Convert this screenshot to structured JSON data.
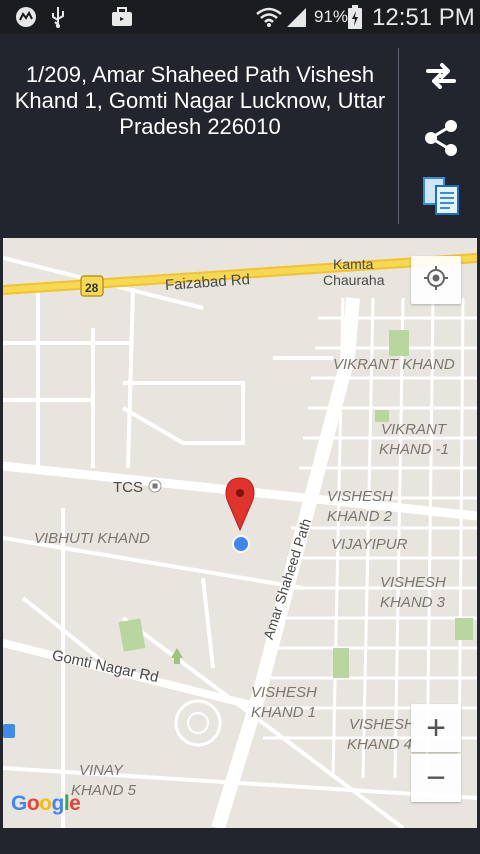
{
  "status_bar": {
    "icons": [
      "messenger-icon",
      "usb-icon",
      "briefcase-icon",
      "wifi-icon",
      "signal-icon",
      "battery-charging-icon"
    ],
    "battery": "91%",
    "time": "12:51 PM"
  },
  "header": {
    "address": "1/209, Amar Shaheed Path Vishesh Khand 1, Gomti Nagar Lucknow, Uttar Pradesh 226010",
    "actions": [
      "swap-icon",
      "share-icon",
      "copy-icon"
    ]
  },
  "map": {
    "labels": {
      "road_number": "28",
      "faizabad": "Faizabad Rd",
      "kamta1": "Kamta",
      "kamta2": "Chauraha",
      "vikrant_khand": "VIKRANT KHAND",
      "vikrant_khand1_a": "VIKRANT",
      "vikrant_khand1_b": "KHAND -1",
      "tcs": "TCS",
      "vishesh_khand2_a": "VISHESH",
      "vishesh_khand2_b": "KHAND 2",
      "vibhuti_khand": "VIBHUTI KHAND",
      "vijayipur": "VIJAYIPUR",
      "vishesh_khand3_a": "VISHESH",
      "vishesh_khand3_b": "KHAND 3",
      "amar_shaheed_path": "Amar Shaheed Path",
      "gomti_nagar_rd": "Gomti Nagar Rd",
      "vishesh_khand1_a": "VISHESH",
      "vishesh_khand1_b": "KHAND 1",
      "vishesh_khand4_a": "VISHESH",
      "vishesh_khand4_b": "KHAND 4",
      "vinay_khand5_a": "VINAY",
      "vinay_khand5_b": "KHAND 5"
    },
    "zoom_in": "+",
    "zoom_out": "−",
    "attribution": "Google",
    "colors": {
      "land": "#e8e5df",
      "road": "#ffffff",
      "highway": "#f7d24a",
      "park": "#b9d6a0",
      "marker": "#e0332b",
      "location_dot": "#4285f4"
    }
  }
}
